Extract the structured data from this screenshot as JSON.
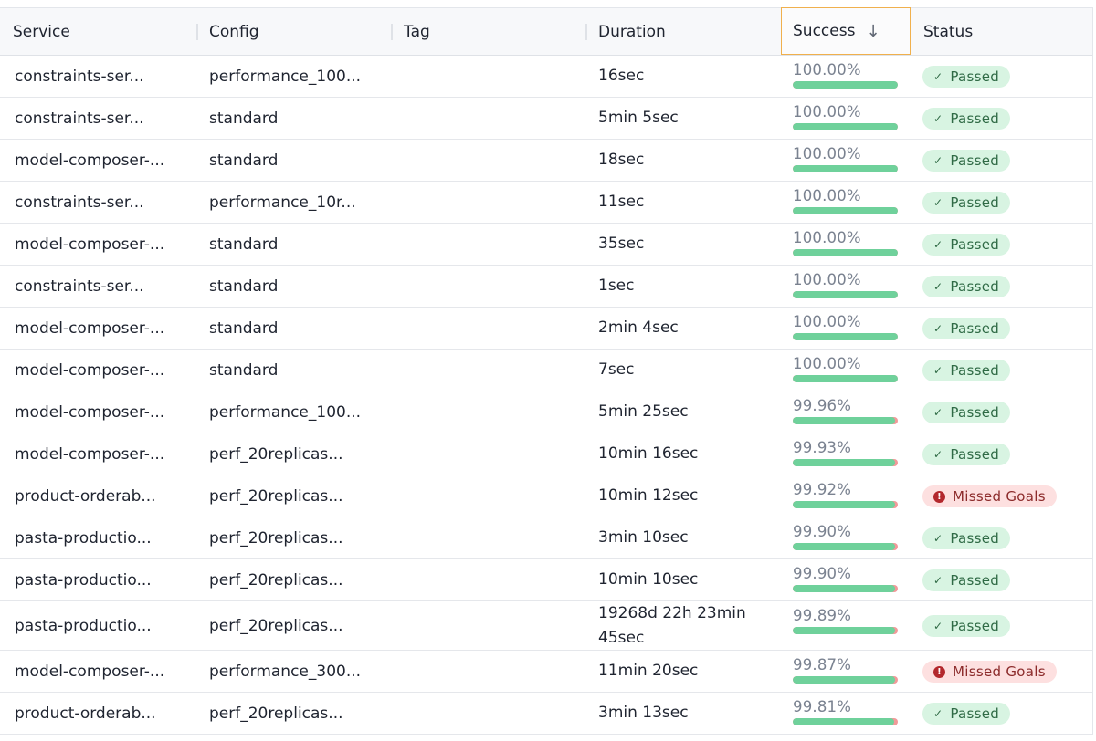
{
  "columns": {
    "service": "Service",
    "config": "Config",
    "tag": "Tag",
    "duration": "Duration",
    "success": "Success",
    "status": "Status"
  },
  "rows": [
    {
      "service": "constraints-ser...",
      "config": "performance_100...",
      "tag": "",
      "duration": "16sec",
      "success": "100.00%",
      "success_value": 100.0,
      "status": "Passed",
      "status_type": "passed"
    },
    {
      "service": "constraints-ser...",
      "config": "standard",
      "tag": "",
      "duration": "5min 5sec",
      "success": "100.00%",
      "success_value": 100.0,
      "status": "Passed",
      "status_type": "passed"
    },
    {
      "service": "model-composer-...",
      "config": "standard",
      "tag": "",
      "duration": "18sec",
      "success": "100.00%",
      "success_value": 100.0,
      "status": "Passed",
      "status_type": "passed"
    },
    {
      "service": "constraints-ser...",
      "config": "performance_10r...",
      "tag": "",
      "duration": "11sec",
      "success": "100.00%",
      "success_value": 100.0,
      "status": "Passed",
      "status_type": "passed"
    },
    {
      "service": "model-composer-...",
      "config": "standard",
      "tag": "",
      "duration": "35sec",
      "success": "100.00%",
      "success_value": 100.0,
      "status": "Passed",
      "status_type": "passed"
    },
    {
      "service": "constraints-ser...",
      "config": "standard",
      "tag": "",
      "duration": "1sec",
      "success": "100.00%",
      "success_value": 100.0,
      "status": "Passed",
      "status_type": "passed"
    },
    {
      "service": "model-composer-...",
      "config": "standard",
      "tag": "",
      "duration": "2min 4sec",
      "success": "100.00%",
      "success_value": 100.0,
      "status": "Passed",
      "status_type": "passed"
    },
    {
      "service": "model-composer-...",
      "config": "standard",
      "tag": "",
      "duration": "7sec",
      "success": "100.00%",
      "success_value": 100.0,
      "status": "Passed",
      "status_type": "passed"
    },
    {
      "service": "model-composer-...",
      "config": "performance_100...",
      "tag": "",
      "duration": "5min 25sec",
      "success": "99.96%",
      "success_value": 99.96,
      "status": "Passed",
      "status_type": "passed"
    },
    {
      "service": "model-composer-...",
      "config": "perf_20replicas...",
      "tag": "",
      "duration": "10min 16sec",
      "success": "99.93%",
      "success_value": 99.93,
      "status": "Passed",
      "status_type": "passed"
    },
    {
      "service": "product-orderab...",
      "config": "perf_20replicas...",
      "tag": "",
      "duration": "10min 12sec",
      "success": "99.92%",
      "success_value": 99.92,
      "status": "Missed Goals",
      "status_type": "missed"
    },
    {
      "service": "pasta-productio...",
      "config": "perf_20replicas...",
      "tag": "",
      "duration": "3min 10sec",
      "success": "99.90%",
      "success_value": 99.9,
      "status": "Passed",
      "status_type": "passed"
    },
    {
      "service": "pasta-productio...",
      "config": "perf_20replicas...",
      "tag": "",
      "duration": "10min 10sec",
      "success": "99.90%",
      "success_value": 99.9,
      "status": "Passed",
      "status_type": "passed"
    },
    {
      "service": "pasta-productio...",
      "config": "perf_20replicas...",
      "tag": "",
      "duration": "19268d 22h 23min 45sec",
      "success": "99.89%",
      "success_value": 99.89,
      "status": "Passed",
      "status_type": "passed"
    },
    {
      "service": "model-composer-...",
      "config": "performance_300...",
      "tag": "",
      "duration": "11min 20sec",
      "success": "99.87%",
      "success_value": 99.87,
      "status": "Missed Goals",
      "status_type": "missed"
    },
    {
      "service": "product-orderab...",
      "config": "perf_20replicas...",
      "tag": "",
      "duration": "3min 13sec",
      "success": "99.81%",
      "success_value": 99.81,
      "status": "Passed",
      "status_type": "passed"
    }
  ],
  "colors": {
    "success_bar": "#6fd19b",
    "failure_bar": "#f19a9a",
    "passed_bg": "#d8f4e2",
    "missed_bg": "#fde0e0",
    "sort_highlight": "#f0b04d"
  },
  "icons": {
    "sort": "arrow-down-icon",
    "passed": "check-icon",
    "missed": "exclamation-circle-icon"
  }
}
